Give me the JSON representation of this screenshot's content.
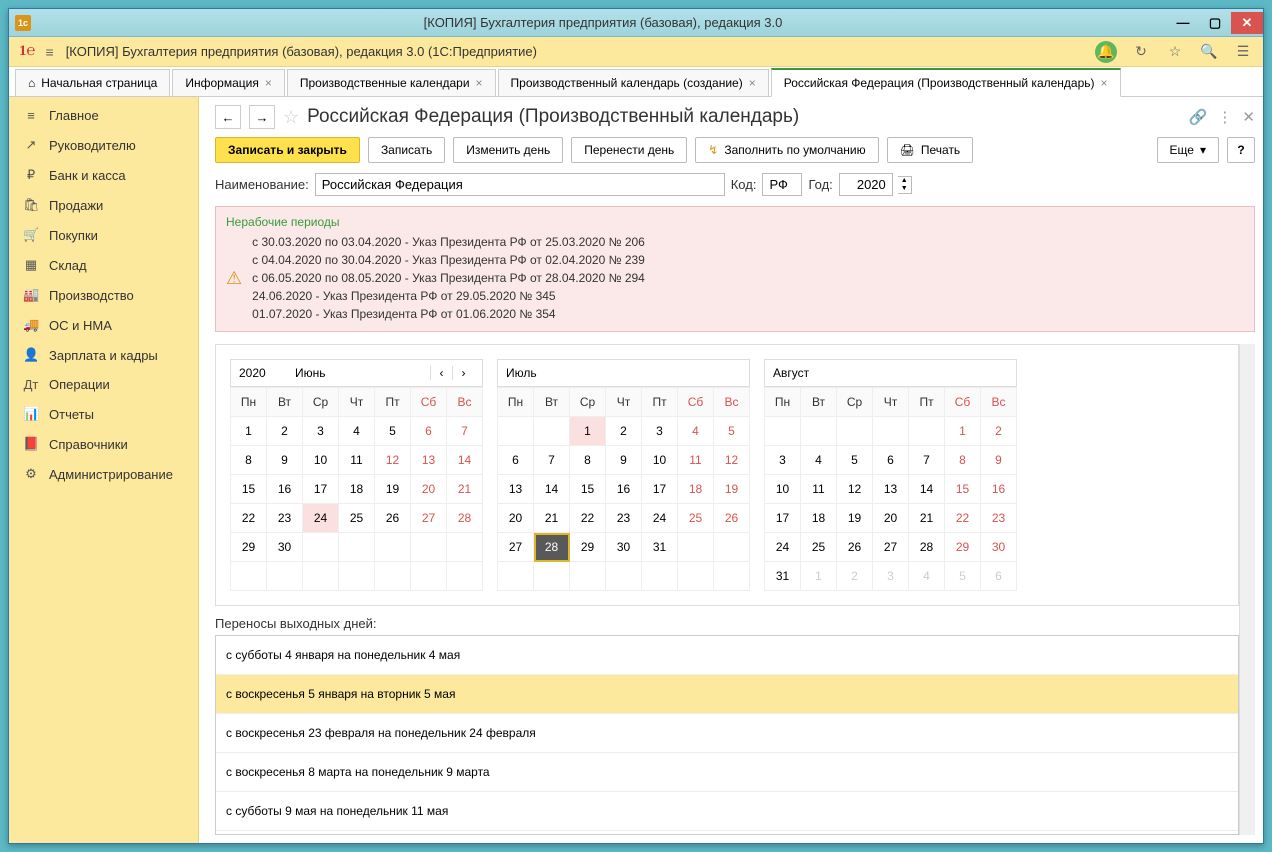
{
  "window_title": "[КОПИЯ] Бухгалтерия предприятия (базовая), редакция 3.0",
  "header_title": "[КОПИЯ] Бухгалтерия предприятия (базовая), редакция 3.0  (1С:Предприятие)",
  "tabs": [
    {
      "label": "Начальная страница",
      "home": true
    },
    {
      "label": "Информация"
    },
    {
      "label": "Производственные календари"
    },
    {
      "label": "Производственный календарь (создание)"
    },
    {
      "label": "Российская Федерация (Производственный календарь)",
      "active": true
    }
  ],
  "sidebar": [
    {
      "icon": "≡",
      "label": "Главное"
    },
    {
      "icon": "↗",
      "label": "Руководителю"
    },
    {
      "icon": "₽",
      "label": "Банк и касса"
    },
    {
      "icon": "🛍",
      "label": "Продажи"
    },
    {
      "icon": "🛒",
      "label": "Покупки"
    },
    {
      "icon": "▦",
      "label": "Склад"
    },
    {
      "icon": "🏭",
      "label": "Производство"
    },
    {
      "icon": "🚚",
      "label": "ОС и НМА"
    },
    {
      "icon": "👤",
      "label": "Зарплата и кадры"
    },
    {
      "icon": "Дт",
      "label": "Операции"
    },
    {
      "icon": "📊",
      "label": "Отчеты"
    },
    {
      "icon": "📕",
      "label": "Справочники"
    },
    {
      "icon": "⚙",
      "label": "Администрирование"
    }
  ],
  "page_title": "Российская Федерация (Производственный календарь)",
  "toolbar": {
    "save_close": "Записать и закрыть",
    "save": "Записать",
    "change_day": "Изменить день",
    "move_day": "Перенести день",
    "fill_default": "Заполнить по умолчанию",
    "print": "Печать",
    "more": "Еще"
  },
  "form": {
    "name_label": "Наименование:",
    "name_value": "Российская Федерация",
    "code_label": "Код:",
    "code_value": "РФ",
    "year_label": "Год:",
    "year_value": "2020"
  },
  "alert": {
    "title": "Нерабочие периоды",
    "lines": [
      "с 30.03.2020 по 03.04.2020 - Указ Президента РФ от 25.03.2020 № 206",
      "с 04.04.2020 по 30.04.2020 - Указ Президента РФ от 02.04.2020 № 239",
      "с 06.05.2020 по 08.05.2020 - Указ Президента РФ от 28.04.2020 № 294",
      "24.06.2020 - Указ Президента РФ от 29.05.2020 № 345",
      "01.07.2020 - Указ Президента РФ от 01.06.2020 № 354"
    ]
  },
  "calendar": {
    "year": "2020",
    "dow": [
      "Пн",
      "Вт",
      "Ср",
      "Чт",
      "Пт",
      "Сб",
      "Вс"
    ],
    "months": [
      {
        "name": "Июнь",
        "nav": true,
        "weeks": [
          [
            {
              "d": 1
            },
            {
              "d": 2
            },
            {
              "d": 3
            },
            {
              "d": 4
            },
            {
              "d": 5
            },
            {
              "d": 6,
              "we": 1
            },
            {
              "d": 7,
              "we": 1
            }
          ],
          [
            {
              "d": 8
            },
            {
              "d": 9
            },
            {
              "d": 10
            },
            {
              "d": 11
            },
            {
              "d": 12,
              "we": 1
            },
            {
              "d": 13,
              "we": 1
            },
            {
              "d": 14,
              "we": 1
            }
          ],
          [
            {
              "d": 15
            },
            {
              "d": 16
            },
            {
              "d": 17
            },
            {
              "d": 18
            },
            {
              "d": 19
            },
            {
              "d": 20,
              "we": 1
            },
            {
              "d": 21,
              "we": 1
            }
          ],
          [
            {
              "d": 22
            },
            {
              "d": 23
            },
            {
              "d": 24,
              "hl": 1
            },
            {
              "d": 25
            },
            {
              "d": 26
            },
            {
              "d": 27,
              "we": 1
            },
            {
              "d": 28,
              "we": 1
            }
          ],
          [
            {
              "d": 29
            },
            {
              "d": 30
            },
            {},
            {},
            {},
            {},
            {}
          ],
          [
            {},
            {},
            {},
            {},
            {},
            {},
            {}
          ]
        ]
      },
      {
        "name": "Июль",
        "weeks": [
          [
            {},
            {},
            {
              "d": 1,
              "hl": 1
            },
            {
              "d": 2
            },
            {
              "d": 3
            },
            {
              "d": 4,
              "we": 1
            },
            {
              "d": 5,
              "we": 1
            }
          ],
          [
            {
              "d": 6
            },
            {
              "d": 7
            },
            {
              "d": 8
            },
            {
              "d": 9
            },
            {
              "d": 10
            },
            {
              "d": 11,
              "we": 1
            },
            {
              "d": 12,
              "we": 1
            }
          ],
          [
            {
              "d": 13
            },
            {
              "d": 14
            },
            {
              "d": 15
            },
            {
              "d": 16
            },
            {
              "d": 17
            },
            {
              "d": 18,
              "we": 1
            },
            {
              "d": 19,
              "we": 1
            }
          ],
          [
            {
              "d": 20
            },
            {
              "d": 21
            },
            {
              "d": 22
            },
            {
              "d": 23
            },
            {
              "d": 24
            },
            {
              "d": 25,
              "we": 1
            },
            {
              "d": 26,
              "we": 1
            }
          ],
          [
            {
              "d": 27
            },
            {
              "d": 28,
              "sel": 1
            },
            {
              "d": 29
            },
            {
              "d": 30
            },
            {
              "d": 31
            },
            {},
            {}
          ],
          [
            {},
            {},
            {},
            {},
            {},
            {},
            {}
          ]
        ]
      },
      {
        "name": "Август",
        "weeks": [
          [
            {},
            {},
            {},
            {},
            {},
            {
              "d": 1,
              "we": 1
            },
            {
              "d": 2,
              "we": 1
            }
          ],
          [
            {
              "d": 3
            },
            {
              "d": 4
            },
            {
              "d": 5
            },
            {
              "d": 6
            },
            {
              "d": 7
            },
            {
              "d": 8,
              "we": 1
            },
            {
              "d": 9,
              "we": 1
            }
          ],
          [
            {
              "d": 10
            },
            {
              "d": 11
            },
            {
              "d": 12
            },
            {
              "d": 13
            },
            {
              "d": 14
            },
            {
              "d": 15,
              "we": 1
            },
            {
              "d": 16,
              "we": 1
            }
          ],
          [
            {
              "d": 17
            },
            {
              "d": 18
            },
            {
              "d": 19
            },
            {
              "d": 20
            },
            {
              "d": 21
            },
            {
              "d": 22,
              "we": 1
            },
            {
              "d": 23,
              "we": 1
            }
          ],
          [
            {
              "d": 24
            },
            {
              "d": 25
            },
            {
              "d": 26
            },
            {
              "d": 27
            },
            {
              "d": 28
            },
            {
              "d": 29,
              "we": 1
            },
            {
              "d": 30,
              "we": 1
            }
          ],
          [
            {
              "d": 31
            },
            {
              "d": 1,
              "ot": 1
            },
            {
              "d": 2,
              "ot": 1
            },
            {
              "d": 3,
              "ot": 1
            },
            {
              "d": 4,
              "ot": 1
            },
            {
              "d": 5,
              "ot": 1
            },
            {
              "d": 6,
              "ot": 1
            }
          ]
        ]
      }
    ]
  },
  "transfers": {
    "label": "Переносы выходных дней:",
    "rows": [
      {
        "t": "с субботы 4 января на понедельник 4 мая"
      },
      {
        "t": "с воскресенья 5 января на вторник 5 мая",
        "sel": true
      },
      {
        "t": "с воскресенья 23 февраля на понедельник 24 февраля"
      },
      {
        "t": "с воскресенья 8 марта на понедельник 9 марта"
      },
      {
        "t": "с субботы 9 мая на понедельник 11 мая"
      }
    ]
  }
}
